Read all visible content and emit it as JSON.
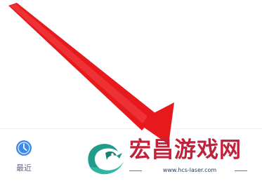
{
  "bottom_nav": {
    "recent": {
      "label": "最近",
      "icon": "clock-icon",
      "color": "#3d8be8"
    }
  },
  "annotation": {
    "icon": "arrow-pointer-icon",
    "color": "#e8191d"
  },
  "watermark": {
    "logo_icon": "dragon-logo-icon",
    "brand": "宏昌游戏网",
    "url": "www.hcs-laser.com",
    "brand_color": "#c0223b",
    "accent_color": "#1f9c8c"
  }
}
